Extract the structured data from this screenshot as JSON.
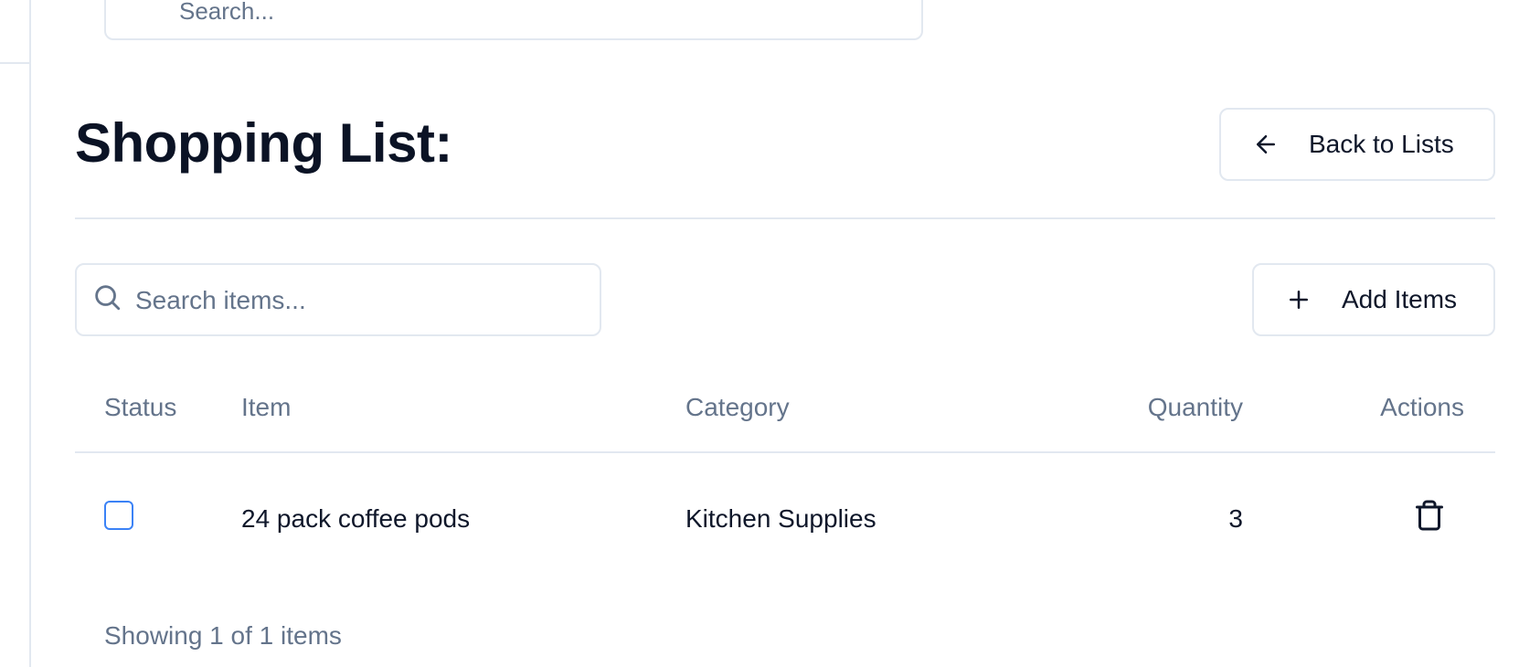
{
  "top_search": {
    "placeholder": "Search..."
  },
  "header": {
    "title": "Shopping List:",
    "back_button": {
      "label": "Back to Lists",
      "icon": "arrow-left-icon"
    }
  },
  "toolbar": {
    "search_placeholder": "Search items...",
    "search_icon": "search-icon",
    "add_button": {
      "label": "Add Items",
      "icon": "plus-icon"
    }
  },
  "table": {
    "columns": [
      "Status",
      "Item",
      "Category",
      "Quantity",
      "Actions"
    ],
    "rows": [
      {
        "checked": false,
        "item": "24 pack coffee pods",
        "category": "Kitchen Supplies",
        "quantity": "3",
        "action_icon": "trash-icon"
      }
    ]
  },
  "footer": {
    "summary": "Showing 1 of 1 items"
  },
  "colors": {
    "accent": "#3b82f6",
    "muted_text": "#64748b",
    "border": "#e2e8f0",
    "title": "#0b1325"
  }
}
